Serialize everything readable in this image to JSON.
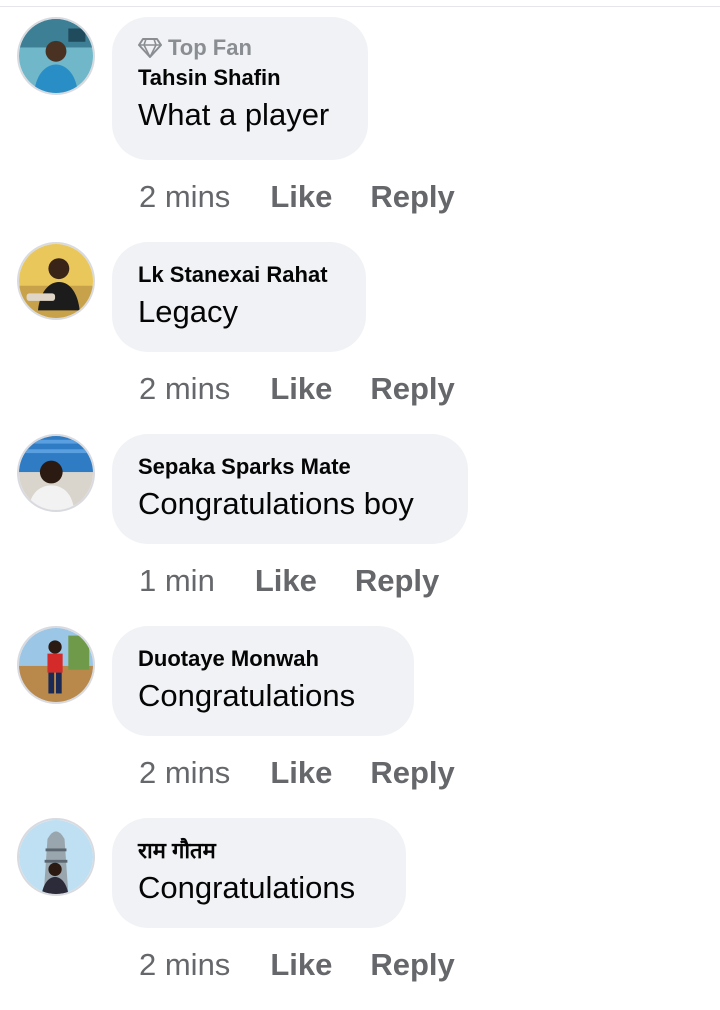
{
  "comments": [
    {
      "badge": "Top Fan",
      "badge_icon": "diamond-icon",
      "author": "Tahsin Shafin",
      "text": "What a player",
      "time": "2 mins",
      "like_label": "Like",
      "reply_label": "Reply"
    },
    {
      "author": "Lk Stanexai Rahat",
      "text": "Legacy",
      "time": "2 mins",
      "like_label": "Like",
      "reply_label": "Reply"
    },
    {
      "author": "Sepaka Sparks Mate",
      "text": "Congratulations boy",
      "time": "1 min",
      "like_label": "Like",
      "reply_label": "Reply"
    },
    {
      "author": "Duotaye Monwah",
      "text": "Congratulations",
      "time": "2 mins",
      "like_label": "Like",
      "reply_label": "Reply"
    },
    {
      "author": "राम गौतम",
      "text": "Congratulations",
      "time": "2 mins",
      "like_label": "Like",
      "reply_label": "Reply"
    }
  ],
  "colors": {
    "bubble_bg": "#f0f2f5",
    "primary_text": "#050505",
    "secondary_text": "#65676b",
    "badge_text": "#8a8d91"
  }
}
